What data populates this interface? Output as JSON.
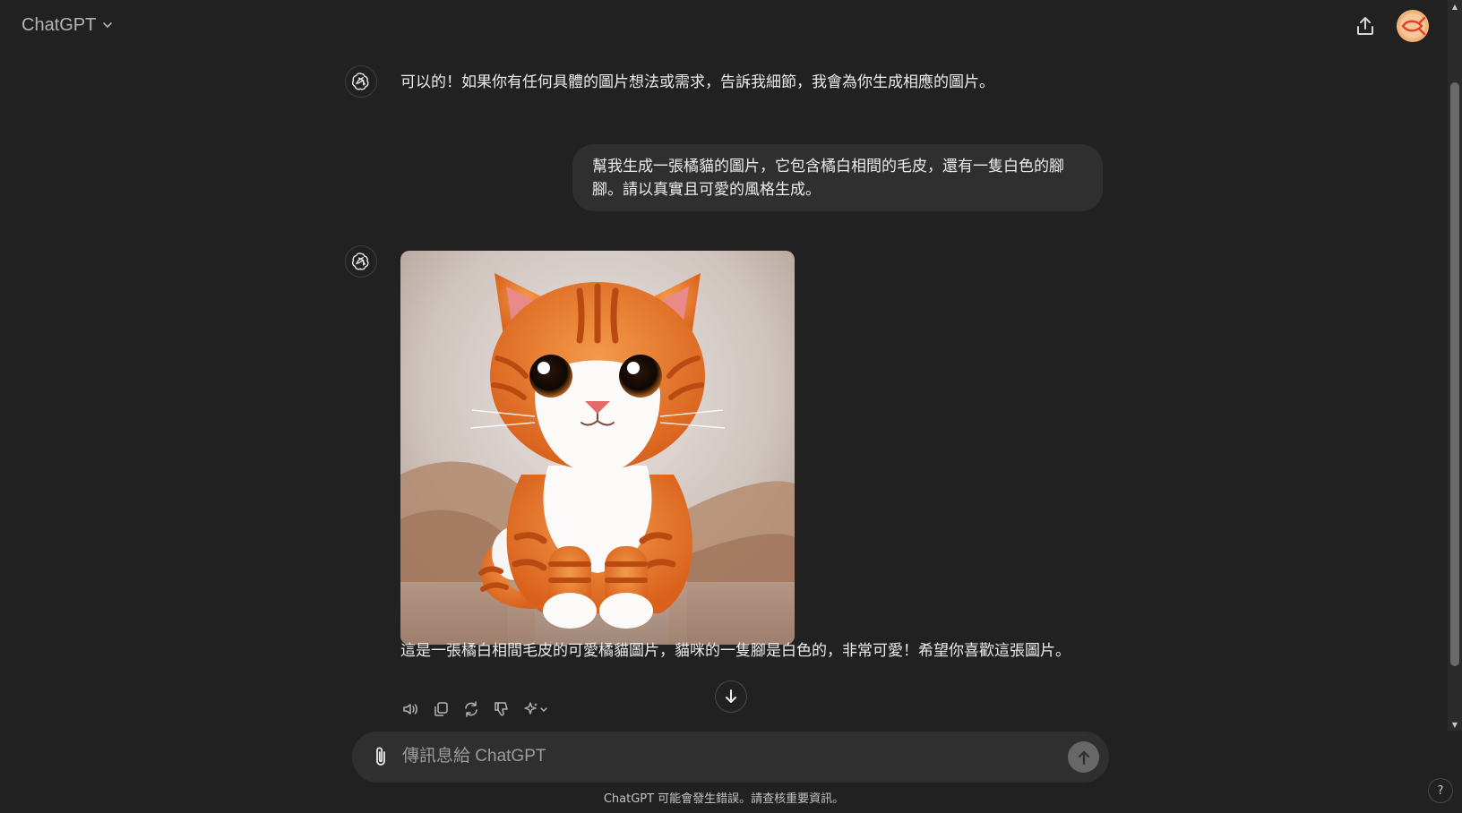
{
  "header": {
    "model_name": "ChatGPT",
    "share_icon": "share-upload-icon",
    "avatar_icon": "user-avatar-icon"
  },
  "conversation": {
    "assistant_message_1": "可以的！如果你有任何具體的圖片想法或需求，告訴我細節，我會為你生成相應的圖片。",
    "user_message_lines": [
      "幫我生成一張橘貓的圖片，它包含橘白相間的毛皮，還有一隻白色的腳",
      "腳。請以真實且可愛的風格生成。"
    ],
    "assistant_image_alt": "cute orange and white tabby kitten sitting on a blanket",
    "assistant_message_2": "這是一張橘白相間毛皮的可愛橘貓圖片，貓咪的一隻腳是白色的，非常可愛！希望你喜歡這張圖片。"
  },
  "actions": {
    "icons": [
      "read-aloud-icon",
      "copy-icon",
      "regenerate-icon",
      "thumbs-down-icon",
      "sparkle-model-icon"
    ]
  },
  "composer": {
    "placeholder": "傳訊息給 ChatGPT",
    "value": ""
  },
  "footer": {
    "disclaimer": "ChatGPT 可能會發生錯誤。請查核重要資訊。",
    "help_label": "?"
  },
  "colors": {
    "background": "#212121",
    "bubble": "#2f2f2f",
    "text": "#ececec",
    "muted": "#b4b4b4"
  }
}
